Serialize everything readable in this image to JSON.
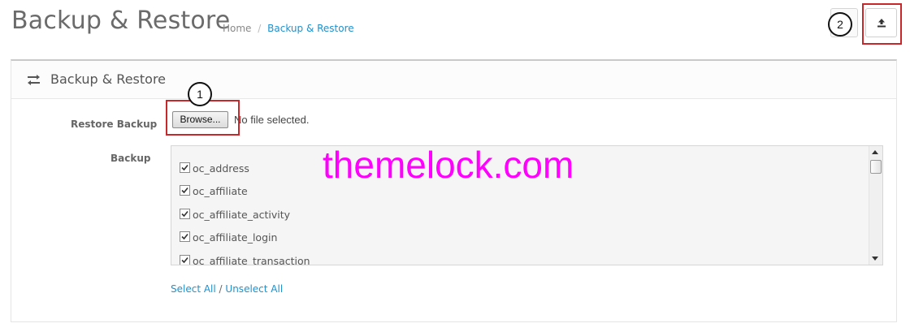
{
  "header": {
    "title": "Backup & Restore",
    "breadcrumb": [
      {
        "label": "Home"
      },
      {
        "separator": "/"
      },
      {
        "label": "Backup & Restore"
      }
    ],
    "restore_button_icon": "upload-icon"
  },
  "callouts": {
    "one": "1",
    "two": "2"
  },
  "panel": {
    "heading": "Backup & Restore",
    "heading_icon": "exchange-icon",
    "restore_label": "Restore Backup",
    "browse_label": "Browse...",
    "file_status": "No file selected.",
    "backup_label": "Backup",
    "tables": [
      {
        "name": "oc_address",
        "checked": true
      },
      {
        "name": "oc_affiliate",
        "checked": true
      },
      {
        "name": "oc_affiliate_activity",
        "checked": true
      },
      {
        "name": "oc_affiliate_login",
        "checked": true
      },
      {
        "name": "oc_affiliate_transaction",
        "checked": true
      }
    ],
    "select_all": "Select All",
    "divider": "/",
    "unselect_all": "Unselect All"
  },
  "watermark": "themelock.com",
  "colors": {
    "link": "#1e91cf",
    "highlight": "#c8282b",
    "watermark": "#ff00ff"
  }
}
